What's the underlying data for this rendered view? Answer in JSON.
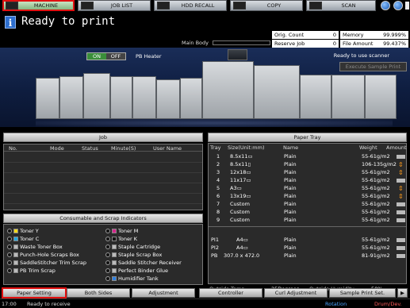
{
  "tabs": [
    {
      "label": "MACHINE",
      "active": true
    },
    {
      "label": "JOB LIST",
      "active": false
    },
    {
      "label": "HDD RECALL",
      "active": false
    },
    {
      "label": "COPY",
      "active": false
    },
    {
      "label": "SCAN",
      "active": false
    }
  ],
  "header": {
    "status": "Ready to print",
    "info_icon_glyph": "i"
  },
  "counters": {
    "orig_count_label": "Orig. Count",
    "orig_count_value": "0",
    "memory_label": "Memory",
    "memory_value": "99.999%",
    "reserve_job_label": "Reserve Job",
    "reserve_job_value": "0",
    "file_amount_label": "File Amount",
    "file_amount_value": "99.437%"
  },
  "main_body_label": "Main Body",
  "pb_heater": {
    "on_label": "ON",
    "off_label": "OFF",
    "label": "PB Heater",
    "state": "ON"
  },
  "scanner_status": "Ready to use scanner",
  "execute_sample_label": "Execute Sample Print",
  "job": {
    "title": "Job",
    "columns": [
      "No.",
      "Mode",
      "Status",
      "Minute(S)",
      "User Name"
    ]
  },
  "indicators": {
    "title": "Consumable and Scrap Indicators",
    "left": [
      "Toner Y",
      "Toner C",
      "Waste Toner Box",
      "Punch-Hole Scraps Box",
      "SaddleStitcher Trim Scrap",
      "PB Trim Scrap"
    ],
    "right": [
      "Toner M",
      "Toner K",
      "Staple Cartridge",
      "Staple Scrap Box",
      "Saddle Stitcher Receiver",
      "Perfect Binder Glue",
      "Humidifier Tank"
    ],
    "colors": {
      "yellow": "#f2d81a",
      "cyan": "#22a7e0",
      "magenta": "#d6268c",
      "black": "#111111"
    }
  },
  "paper_tray": {
    "title": "Paper Tray",
    "columns": [
      "Tray",
      "Size(Unit:mm)",
      "Name",
      "Weight",
      "Amount"
    ],
    "rows": [
      {
        "tray": "1",
        "size": "8.5x11▭",
        "name": "Plain",
        "weight": "55-61g/m2",
        "warn": false
      },
      {
        "tray": "2",
        "size": "8.5x11▯",
        "name": "Plain",
        "weight": "106-135g/m2",
        "warn": true
      },
      {
        "tray": "3",
        "size": "12x18▭",
        "name": "Plain",
        "weight": "55-61g/m2",
        "warn": true
      },
      {
        "tray": "4",
        "size": "11x17▭",
        "name": "Plain",
        "weight": "55-61g/m2",
        "warn": false
      },
      {
        "tray": "5",
        "size": "A3▭",
        "name": "Plain",
        "weight": "55-61g/m2",
        "warn": true
      },
      {
        "tray": "6",
        "size": "13x19▭",
        "name": "Plain",
        "weight": "55-61g/m2",
        "warn": true
      },
      {
        "tray": "7",
        "size": "Custom",
        "name": "Plain",
        "weight": "55-61g/m2",
        "warn": false
      },
      {
        "tray": "8",
        "size": "Custom",
        "name": "Plain",
        "weight": "55-61g/m2",
        "warn": false
      },
      {
        "tray": "9",
        "size": "Custom",
        "name": "Plain",
        "weight": "55-61g/m2",
        "warn": false
      }
    ],
    "inserter_rows": [
      {
        "tray": "PI1",
        "size": "A4▭",
        "name": "Plain",
        "weight": "55-61g/m2"
      },
      {
        "tray": "PI2",
        "size": "A4▭",
        "name": "Plain",
        "weight": "55-61g/m2"
      },
      {
        "tray": "PB",
        "size": "307.0 x 472.0",
        "name": "Plain",
        "weight": "81-91g/m2"
      }
    ],
    "warn_glyph": "⇕"
  },
  "environment": {
    "outside_temp_label": "Outside Temp.",
    "outside_temp_value": "25Degrees",
    "outside_humidity_label": "Outside Humidity",
    "outside_humidity_value": "50%"
  },
  "bottom_buttons": [
    "Paper Setting",
    "Both Sides",
    "Adjustment",
    "Controller",
    "Curl Adjustment",
    "Sample Print Set."
  ],
  "status_bar": {
    "time": "17:00",
    "receive_label": "Ready to receive",
    "rotation_label": "Rotation",
    "drum_label": "Drum/Dev."
  }
}
